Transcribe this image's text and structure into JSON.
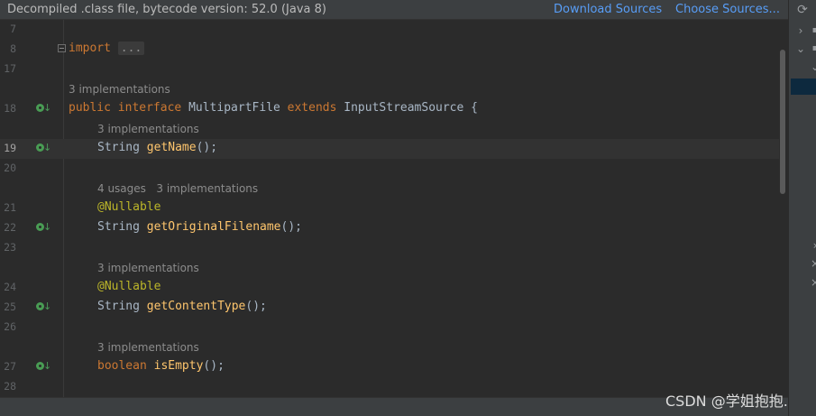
{
  "banner": {
    "message": "Decompiled .class file, bytecode version: 52.0 (Java 8)",
    "download_sources": "Download Sources",
    "choose_sources": "Choose Sources..."
  },
  "editor": {
    "lines": {
      "l7": "7",
      "l8": "8",
      "l17": "17",
      "l18": "18",
      "l19": "19",
      "l20": "20",
      "l21": "21",
      "l22": "22",
      "l23": "23",
      "l24": "24",
      "l25": "25",
      "l26": "26",
      "l27": "27",
      "l28": "28"
    },
    "code": {
      "import_kw": "import",
      "import_folded": "...",
      "hint_interface": "3 implementations",
      "public": "public",
      "interface": "interface",
      "type_name": "MultipartFile",
      "extends": "extends",
      "super_type": "InputStreamSource",
      "open_brace": "{",
      "hint_getname": "3 implementations",
      "string1": "String",
      "getname": "getName",
      "parens1": "();",
      "hint_usages": "4 usages",
      "hint_getorig": "3 implementations",
      "nullable1": "@Nullable",
      "string2": "String",
      "getorig": "getOriginalFilename",
      "parens2": "();",
      "hint_getct": "3 implementations",
      "nullable2": "@Nullable",
      "string3": "String",
      "getct": "getContentType",
      "parens3": "();",
      "hint_isempty": "3 implementations",
      "boolean": "boolean",
      "isempty": "isEmpty",
      "parens4": "();"
    }
  },
  "watermark": "CSDN @学姐抱抱.",
  "colors": {
    "background": "#2b2b2b",
    "keyword": "#cc7832",
    "method": "#ffc66d",
    "annotation": "#bbb529",
    "link": "#589df6"
  },
  "icons": [
    "implemented-icon",
    "refresh-icon",
    "chevron-right-icon",
    "chevron-down-icon",
    "close-icon"
  ]
}
